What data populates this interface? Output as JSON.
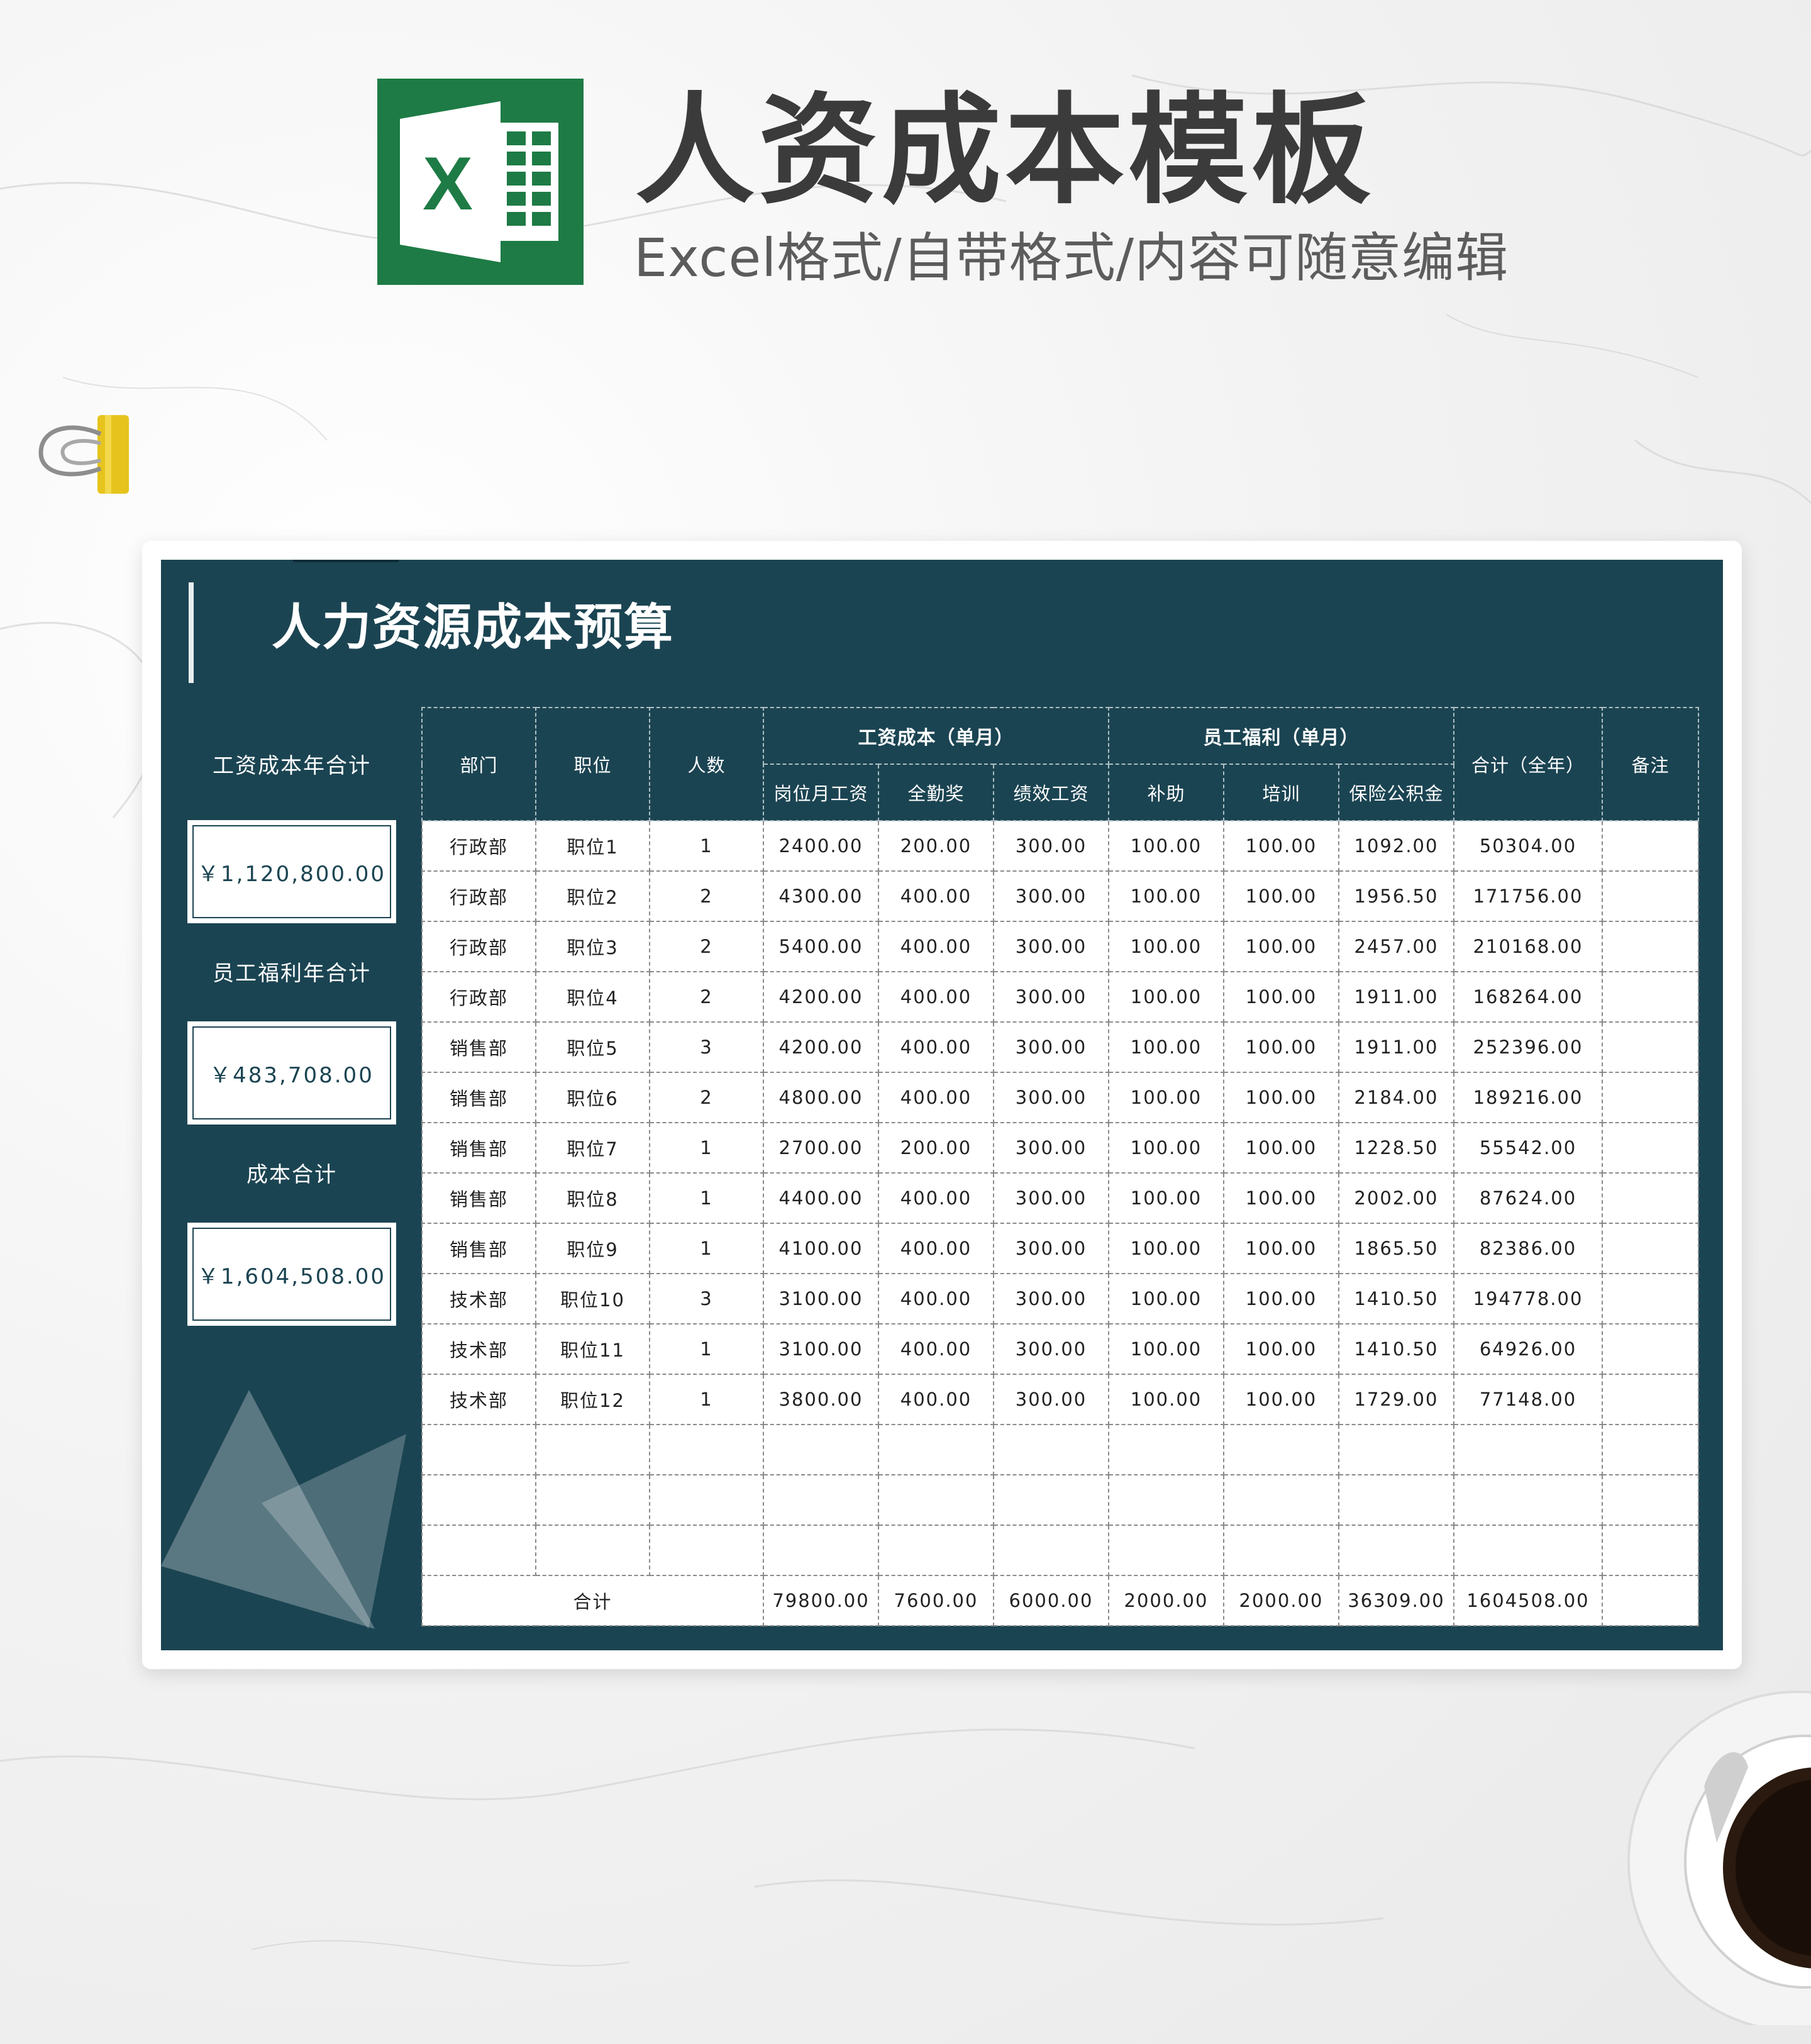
{
  "header": {
    "title": "人资成本模板",
    "subtitle": "Excel格式/自带格式/内容可随意编辑",
    "logo_letter": "X"
  },
  "sheet": {
    "title": "人力资源成本预算",
    "summary": [
      {
        "label": "工资成本年合计",
        "value": "￥1,120,800.00"
      },
      {
        "label": "员工福利年合计",
        "value": "￥483,708.00"
      },
      {
        "label": "成本合计",
        "value": "￥1,604,508.00"
      }
    ]
  },
  "table": {
    "headers": {
      "dept": "部门",
      "position": "职位",
      "count": "人数",
      "salary_group": "工资成本（单月）",
      "welfare_group": "员工福利（单月）",
      "total": "合计（全年）",
      "remark": "备注",
      "base": "岗位月工资",
      "attendance": "全勤奖",
      "performance": "绩效工资",
      "subsidy": "补助",
      "training": "培训",
      "insurance": "保险公积金"
    },
    "rows": [
      [
        "行政部",
        "职位1",
        "1",
        "2400.00",
        "200.00",
        "300.00",
        "100.00",
        "100.00",
        "1092.00",
        "50304.00",
        ""
      ],
      [
        "行政部",
        "职位2",
        "2",
        "4300.00",
        "400.00",
        "300.00",
        "100.00",
        "100.00",
        "1956.50",
        "171756.00",
        ""
      ],
      [
        "行政部",
        "职位3",
        "2",
        "5400.00",
        "400.00",
        "300.00",
        "100.00",
        "100.00",
        "2457.00",
        "210168.00",
        ""
      ],
      [
        "行政部",
        "职位4",
        "2",
        "4200.00",
        "400.00",
        "300.00",
        "100.00",
        "100.00",
        "1911.00",
        "168264.00",
        ""
      ],
      [
        "销售部",
        "职位5",
        "3",
        "4200.00",
        "400.00",
        "300.00",
        "100.00",
        "100.00",
        "1911.00",
        "252396.00",
        ""
      ],
      [
        "销售部",
        "职位6",
        "2",
        "4800.00",
        "400.00",
        "300.00",
        "100.00",
        "100.00",
        "2184.00",
        "189216.00",
        ""
      ],
      [
        "销售部",
        "职位7",
        "1",
        "2700.00",
        "200.00",
        "300.00",
        "100.00",
        "100.00",
        "1228.50",
        "55542.00",
        ""
      ],
      [
        "销售部",
        "职位8",
        "1",
        "4400.00",
        "400.00",
        "300.00",
        "100.00",
        "100.00",
        "2002.00",
        "87624.00",
        ""
      ],
      [
        "销售部",
        "职位9",
        "1",
        "4100.00",
        "400.00",
        "300.00",
        "100.00",
        "100.00",
        "1865.50",
        "82386.00",
        ""
      ],
      [
        "技术部",
        "职位10",
        "3",
        "3100.00",
        "400.00",
        "300.00",
        "100.00",
        "100.00",
        "1410.50",
        "194778.00",
        ""
      ],
      [
        "技术部",
        "职位11",
        "1",
        "3100.00",
        "400.00",
        "300.00",
        "100.00",
        "100.00",
        "1410.50",
        "64926.00",
        ""
      ],
      [
        "技术部",
        "职位12",
        "1",
        "3800.00",
        "400.00",
        "300.00",
        "100.00",
        "100.00",
        "1729.00",
        "77148.00",
        ""
      ],
      [
        "",
        "",
        "",
        "",
        "",
        "",
        "",
        "",
        "",
        "",
        ""
      ],
      [
        "",
        "",
        "",
        "",
        "",
        "",
        "",
        "",
        "",
        "",
        ""
      ],
      [
        "",
        "",
        "",
        "",
        "",
        "",
        "",
        "",
        "",
        "",
        ""
      ]
    ],
    "total_row": {
      "label": "合计",
      "values": [
        "79800.00",
        "7600.00",
        "6000.00",
        "2000.00",
        "2000.00",
        "36309.00",
        "1604508.00",
        ""
      ]
    }
  },
  "colors": {
    "sheet_bg": "#1b4452",
    "excel_green": "#1e7b45"
  }
}
